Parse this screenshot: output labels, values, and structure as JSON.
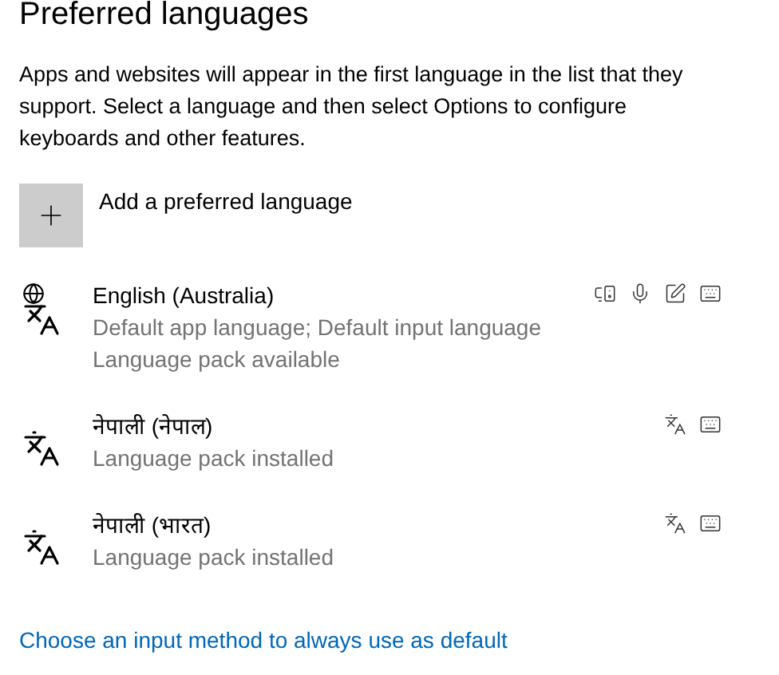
{
  "title": "Preferred languages",
  "description": "Apps and websites will appear in the first language in the list that they support. Select a language and then select Options to configure keyboards and other features.",
  "add_button": {
    "label": "Add a preferred language"
  },
  "languages": [
    {
      "name": "English (Australia)",
      "details": [
        "Default app language; Default input language",
        "Language pack available"
      ],
      "globe": true,
      "features": [
        {
          "kind": "speech"
        },
        {
          "kind": "voice"
        },
        {
          "kind": "handwriting"
        },
        {
          "kind": "keyboard"
        }
      ]
    },
    {
      "name": "नेपाली (नेपाल)",
      "details": [
        "Language pack installed"
      ],
      "globe": false,
      "features": [
        {
          "kind": "display"
        },
        {
          "kind": "keyboard"
        }
      ]
    },
    {
      "name": "नेपाली (भारत)",
      "details": [
        "Language pack installed"
      ],
      "globe": false,
      "features": [
        {
          "kind": "display"
        },
        {
          "kind": "keyboard"
        }
      ]
    }
  ],
  "link": "Choose an input method to always use as default"
}
